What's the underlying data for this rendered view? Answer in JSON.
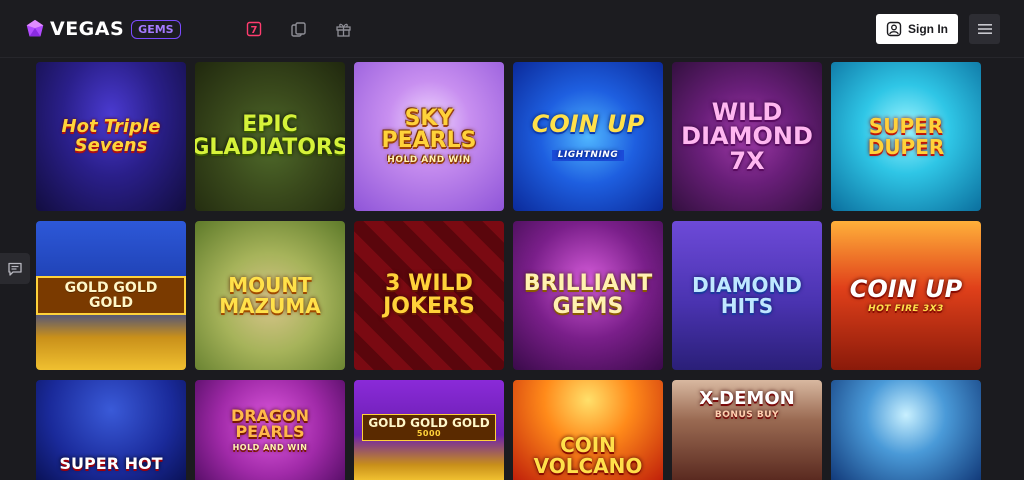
{
  "header": {
    "logo_text": "VEGAS",
    "logo_badge": "GEMS",
    "nav_icons": [
      "slots-seven-icon",
      "cards-icon",
      "gift-icon"
    ],
    "nav_seven_glyph": "7",
    "signin_label": "Sign In",
    "accent_color": "#7b4bff",
    "seven_color": "#ff3c6e"
  },
  "games": [
    {
      "title": "Hot Triple Sevens",
      "sub": ""
    },
    {
      "title": "EPIC GLADIATORS",
      "sub": ""
    },
    {
      "title": "SKY PEARLS",
      "sub": "HOLD AND WIN"
    },
    {
      "title": "COIN UP",
      "sub": "LIGHTNING"
    },
    {
      "title": "WILD DIAMOND 7X",
      "sub": ""
    },
    {
      "title": "SUPER DUPER",
      "sub": ""
    },
    {
      "title": "GOLD GOLD GOLD",
      "sub": ""
    },
    {
      "title": "MOUNT MAZUMA",
      "sub": ""
    },
    {
      "title": "3 WILD JOKERS",
      "sub": ""
    },
    {
      "title": "BRILLIANT GEMS",
      "sub": ""
    },
    {
      "title": "DIAMOND HITS",
      "sub": ""
    },
    {
      "title": "COIN UP",
      "sub": "HOT FIRE 3X3"
    },
    {
      "title": "SUPER HOT",
      "sub": ""
    },
    {
      "title": "DRAGON PEARLS",
      "sub": "HOLD AND WIN"
    },
    {
      "title": "GOLD GOLD GOLD",
      "sub": "5000"
    },
    {
      "title": "COIN VOLCANO",
      "sub": ""
    },
    {
      "title": "X-DEMON",
      "sub": "BONUS BUY"
    },
    {
      "title": "",
      "sub": ""
    }
  ]
}
